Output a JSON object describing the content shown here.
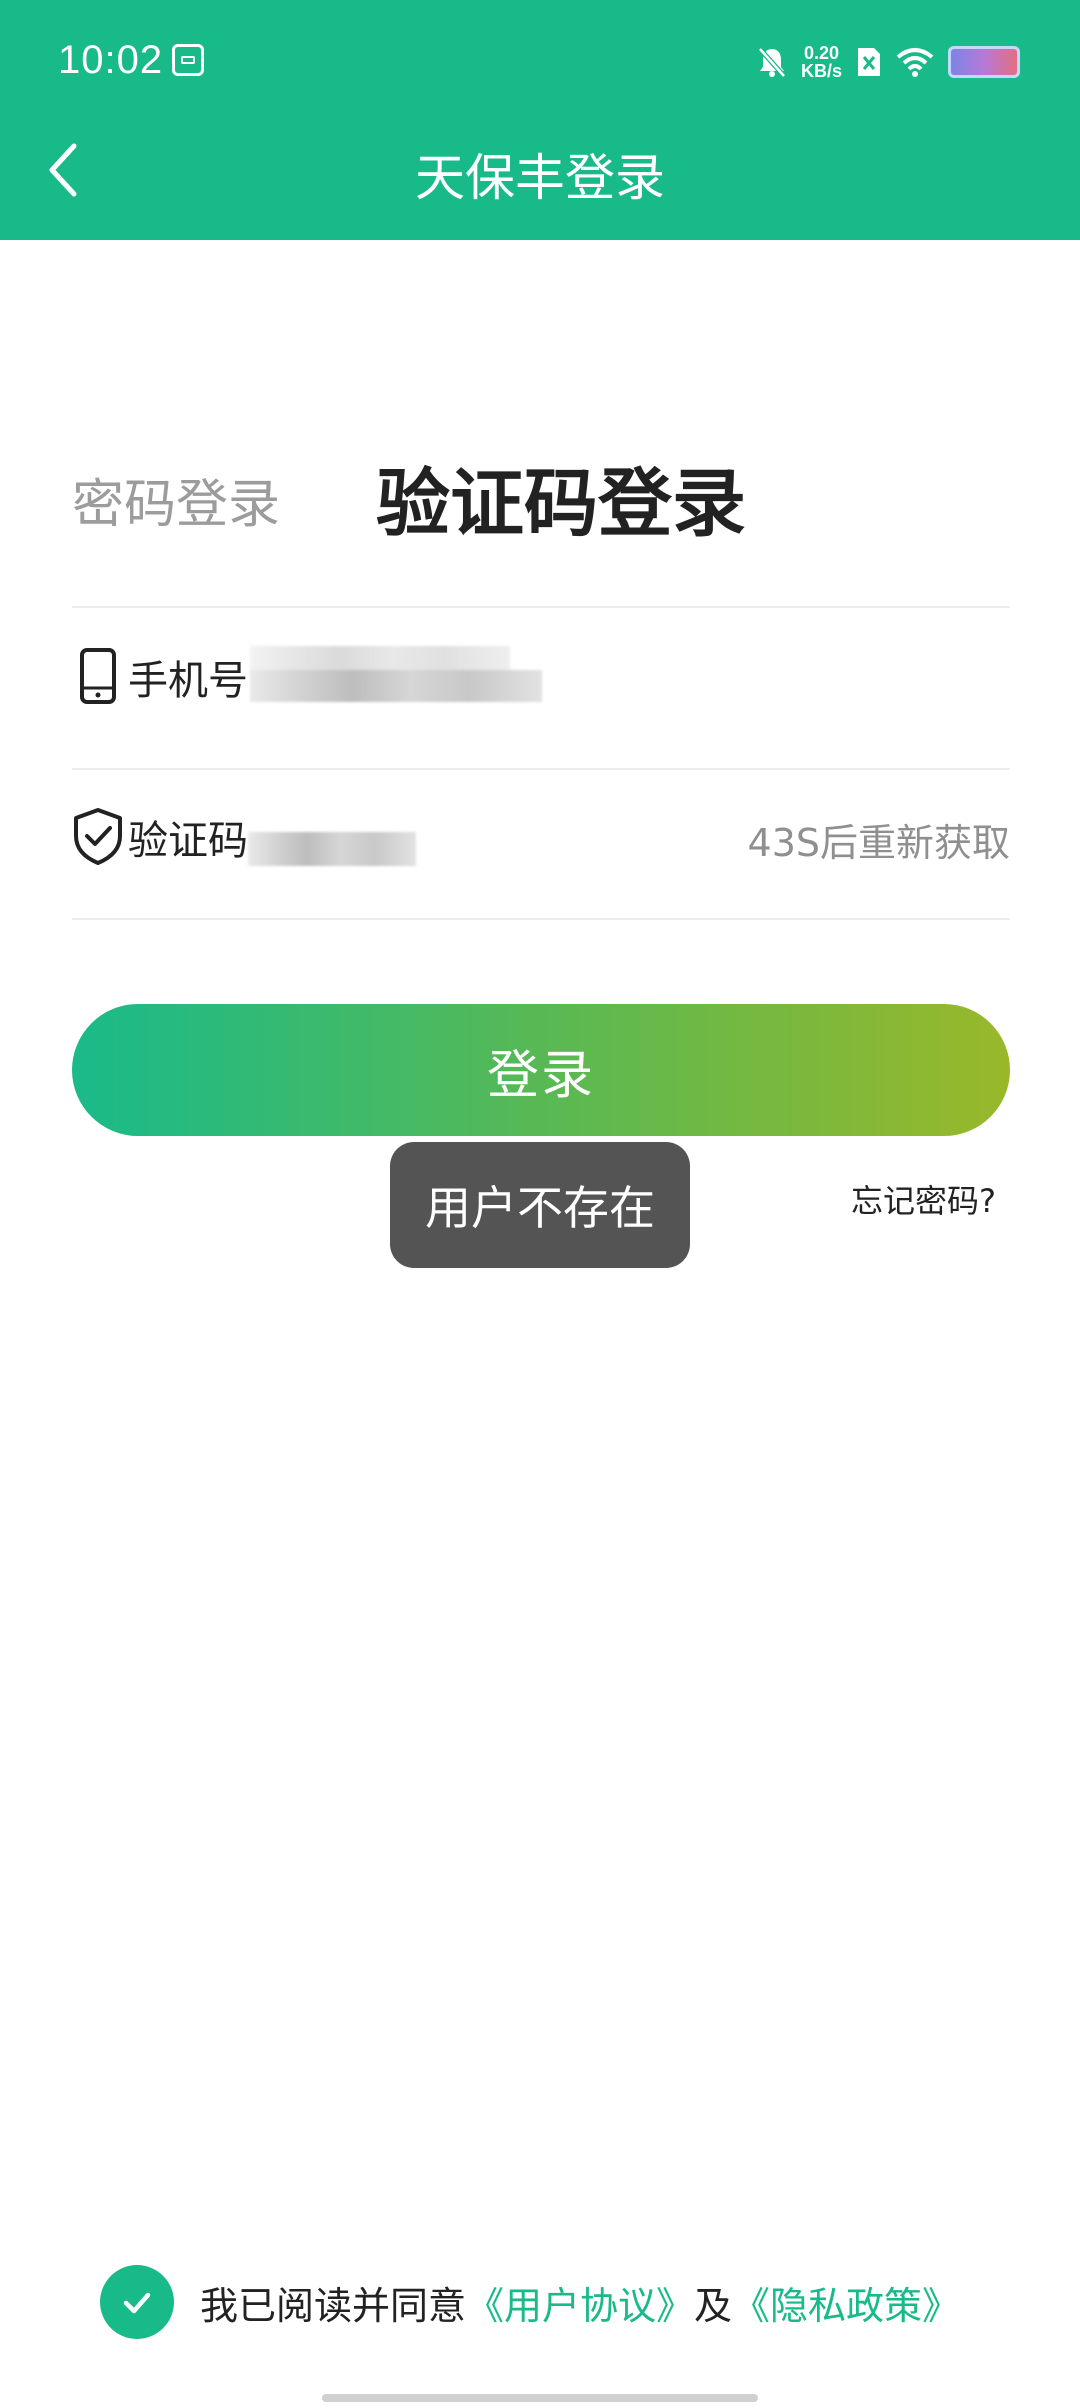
{
  "status_bar": {
    "time": "10:02",
    "net_speed_value": "0.20",
    "net_speed_unit": "KB/s",
    "icons": [
      "calendar-icon",
      "mute-bell-icon",
      "sim-x-icon",
      "wifi-icon",
      "battery-icon"
    ]
  },
  "header": {
    "title": "天保丰登录",
    "back_icon": "chevron-left-icon"
  },
  "tabs": {
    "password_login": "密码登录",
    "code_login": "验证码登录",
    "active": "code_login"
  },
  "form": {
    "phone_label": "手机号",
    "phone_icon": "phone-icon",
    "code_label": "验证码",
    "code_icon": "shield-check-icon",
    "resend_text": "43S后重新获取"
  },
  "login_button": "登录",
  "toast": "用户不存在",
  "forgot_password": "忘记密码?",
  "agreement": {
    "checked": true,
    "prefix": "我已阅读并同意",
    "user_agreement": "《用户协议》",
    "and": "及",
    "privacy_policy": "《隐私政策》"
  },
  "colors": {
    "brand": "#19ba8a",
    "gradient_end": "#99b82a",
    "toast_bg": "#545454"
  }
}
